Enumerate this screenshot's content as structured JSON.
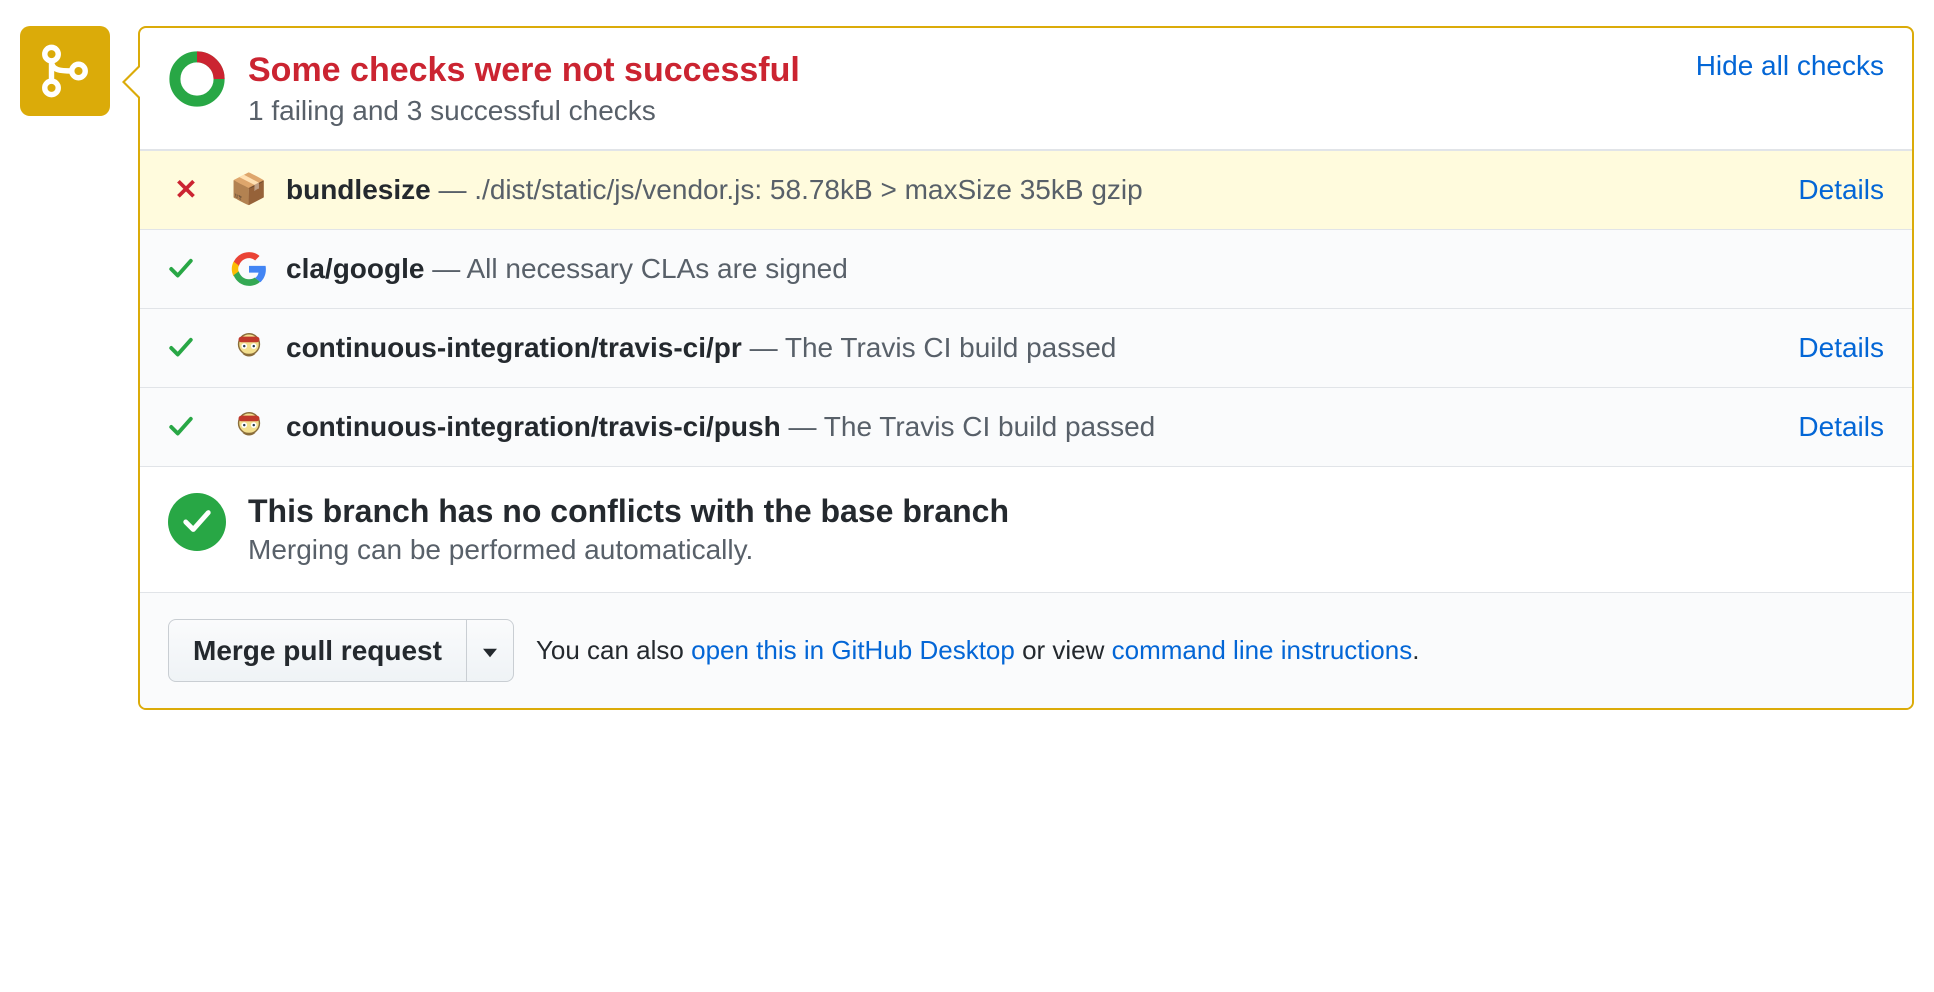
{
  "status": {
    "title": "Some checks were not successful",
    "subtitle": "1 failing and 3 successful checks",
    "toggle_label": "Hide all checks",
    "donut_fail_fraction": 0.25
  },
  "checks": [
    {
      "state": "fail",
      "avatar": "package-icon",
      "name": "bundlesize",
      "message": "./dist/static/js/vendor.js: 58.78kB > maxSize 35kB gzip",
      "details_label": "Details",
      "has_details": true
    },
    {
      "state": "pass",
      "avatar": "google-icon",
      "name": "cla/google",
      "message": "All necessary CLAs are signed",
      "details_label": "",
      "has_details": false
    },
    {
      "state": "pass",
      "avatar": "travis-icon",
      "name": "continuous-integration/travis-ci/pr",
      "message": "The Travis CI build passed",
      "details_label": "Details",
      "has_details": true
    },
    {
      "state": "pass",
      "avatar": "travis-icon",
      "name": "continuous-integration/travis-ci/push",
      "message": "The Travis CI build passed",
      "details_label": "Details",
      "has_details": true
    }
  ],
  "merge": {
    "title": "This branch has no conflicts with the base branch",
    "subtitle": "Merging can be performed automatically."
  },
  "actions": {
    "merge_button_label": "Merge pull request",
    "hint_prefix": "You can also ",
    "open_desktop_label": "open this in GitHub Desktop",
    "hint_middle": " or view ",
    "cli_label": "command line instructions",
    "hint_suffix": "."
  },
  "colors": {
    "warning": "#dbab09",
    "danger": "#cb2431",
    "success": "#28a745",
    "link": "#0366d6"
  }
}
